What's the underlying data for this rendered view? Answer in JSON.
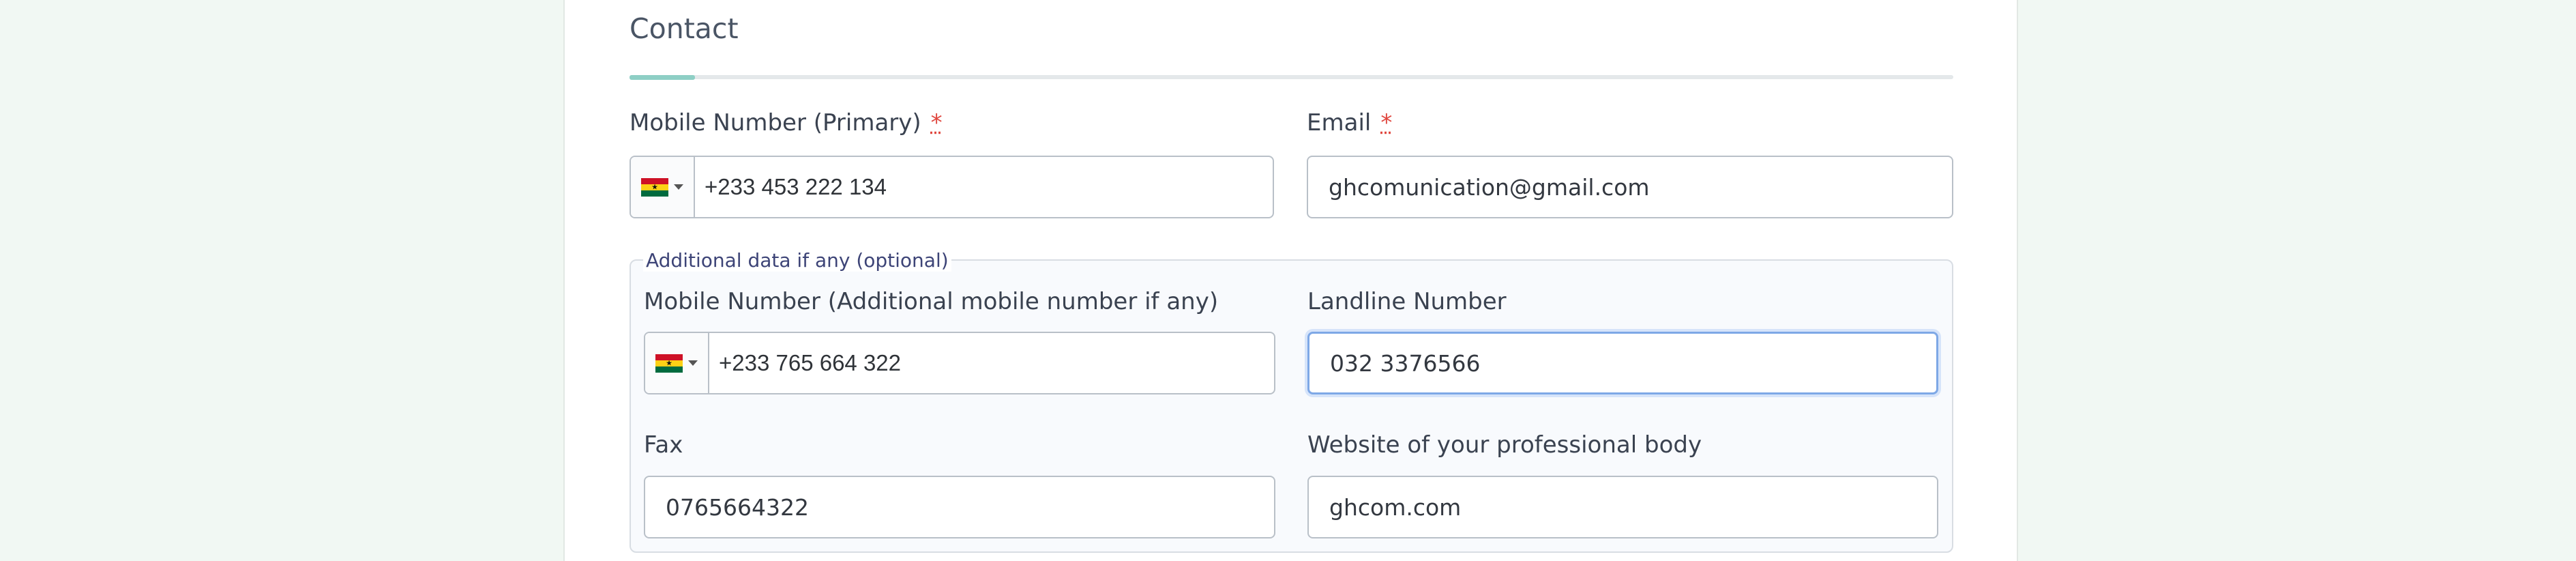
{
  "section": {
    "title": "Contact"
  },
  "primary_mobile": {
    "label": "Mobile Number (Primary)",
    "required_mark": "*",
    "value": "+233 453 222 134"
  },
  "email": {
    "label": "Email",
    "required_mark": "*",
    "value": "ghcomunication@gmail.com"
  },
  "additional": {
    "legend": "Additional data if any (optional)",
    "mobile": {
      "label": "Mobile Number (Additional mobile number if any)",
      "value": "+233 765 664 322"
    },
    "landline": {
      "label": "Landline Number",
      "value": "032 3376566"
    },
    "fax": {
      "label": "Fax",
      "value": "0765664322"
    },
    "website": {
      "label": "Website of your professional body",
      "value": "ghcom.com"
    }
  },
  "colors": {
    "accent": "#8ecfc5",
    "required": "#e0473f",
    "focus": "#7ea8e6",
    "page_bg": "#f1f8f3"
  },
  "icons": {
    "country_flag": "ghana-flag-icon",
    "dropdown": "caret-down-icon"
  }
}
